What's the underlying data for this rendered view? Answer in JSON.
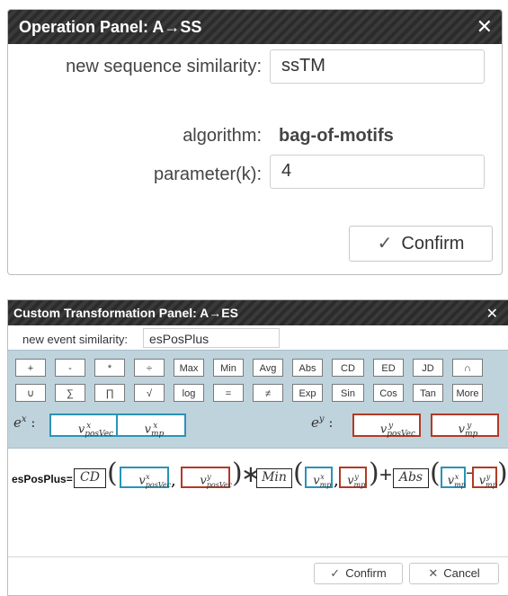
{
  "panel1": {
    "title": "Operation Panel: A→SS",
    "close_glyph": "✕",
    "new_label": "new sequence similarity:",
    "new_value": "ssTM",
    "algo_label": "algorithm:",
    "algo_value": "bag-of-motifs",
    "param_label": "parameter(k):",
    "param_value": "4",
    "confirm_label": "Confirm",
    "confirm_icon": "✓"
  },
  "panel2": {
    "title": "Custom Transformation Panel: A→ES",
    "close_glyph": "✕",
    "new_label": "new event similarity:",
    "new_value": "esPosPlus",
    "ops_row1": [
      "+",
      "-",
      "*",
      "÷",
      "Max",
      "Min",
      "Avg",
      "Abs",
      "CD",
      "ED",
      "JD",
      "∩"
    ],
    "ops_row2": [
      "∪",
      "∑",
      "∏",
      "√",
      "log",
      "=",
      "≠",
      "Exp",
      "Sin",
      "Cos",
      "Tan",
      "More"
    ],
    "ex_label": "e",
    "ex_sup": "x",
    "ey_label": "e",
    "ey_sup": "y",
    "colon": ":",
    "vars": {
      "v": "v",
      "x": "x",
      "y": "y",
      "posVec": "posVec",
      "mp": "mp"
    },
    "formula": {
      "name": "esPosPlus=",
      "cd": "CD",
      "min": "Min",
      "abs": "Abs",
      "times": "∗",
      "plus": "+",
      "minus": "−",
      "comma": ","
    },
    "confirm_label": "Confirm",
    "confirm_icon": "✓",
    "cancel_label": "Cancel",
    "cancel_icon": "✕"
  },
  "colors": {
    "blue": "#2a93b8",
    "red": "#b23a25",
    "ops_bg": "#bfd3dc",
    "titlebar": "#2b2b2b"
  }
}
